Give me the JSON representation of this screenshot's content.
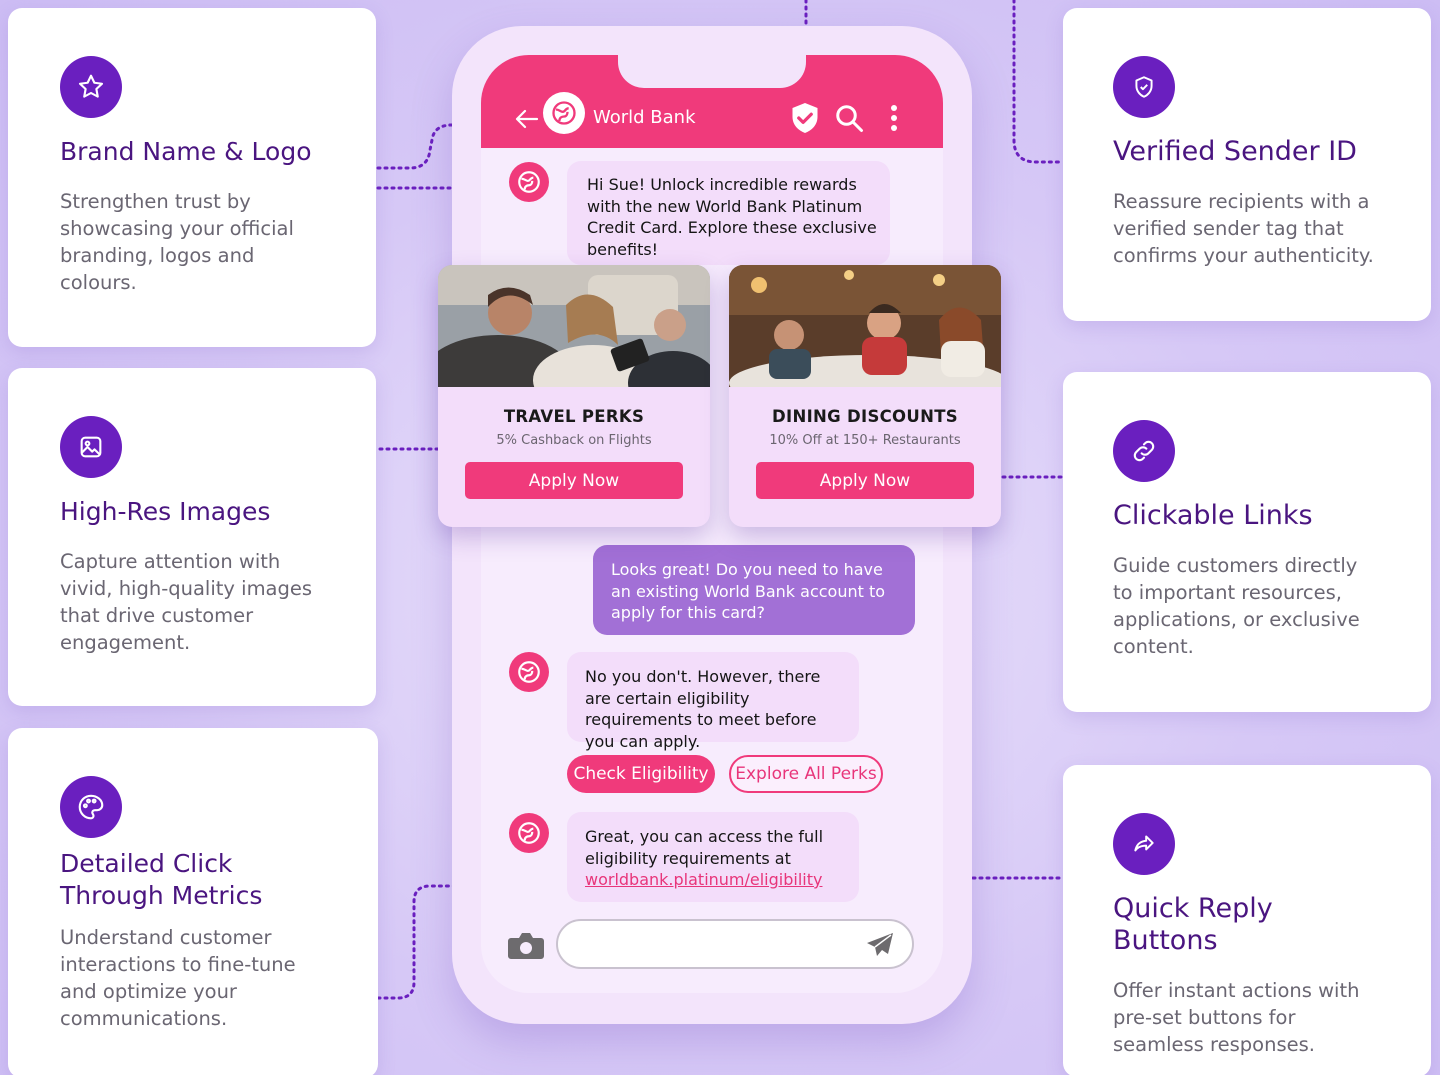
{
  "features": {
    "brand": {
      "title": "Brand Name & Logo",
      "desc": "Strengthen trust by showcasing your official branding, logos and colours.",
      "icon": "star-icon"
    },
    "images": {
      "title": "High-Res Images",
      "desc": "Capture attention with vivid, high-quality images that drive customer engagement.",
      "icon": "image-icon"
    },
    "metrics": {
      "title": "Detailed Click Through Metrics",
      "desc": "Understand customer interactions to fine-tune and optimize your communications.",
      "icon": "palette-icon"
    },
    "verified": {
      "title": "Verified Sender ID",
      "desc": "Reassure recipients with a verified sender tag that confirms your authenticity.",
      "icon": "shield-check-icon"
    },
    "links": {
      "title": "Clickable Links",
      "desc": "Guide customers directly to important resources, applications, or exclusive content.",
      "icon": "link-icon"
    },
    "replies": {
      "title": "Quick Reply Buttons",
      "desc": "Offer instant actions with pre-set buttons for seamless responses.",
      "icon": "share-arrow-icon"
    }
  },
  "phone": {
    "brand_name": "World Bank",
    "messages": {
      "m1": "Hi Sue! Unlock incredible rewards with the new World Bank Platinum Credit Card. Explore these exclusive benefits!",
      "m2": "Looks great! Do you need to have an existing World Bank account to apply for this card?",
      "m3": "No you don't. However, there are certain eligibility requirements to meet before you can apply.",
      "m4_text": "Great, you can access the full eligibility requirements at",
      "m4_link": "worldbank.platinum/eligibility"
    },
    "promos": [
      {
        "title": "TRAVEL PERKS",
        "subtitle": "5% Cashback on Flights",
        "button": "Apply Now"
      },
      {
        "title": "DINING DISCOUNTS",
        "subtitle": "10% Off at 150+ Restaurants",
        "button": "Apply Now"
      }
    ],
    "quick_replies": [
      "Check Eligibility",
      "Explore All Perks"
    ],
    "composer_placeholder": ""
  },
  "colors": {
    "brand_pink": "#f03a7b",
    "badge_purple": "#6a1fbf",
    "title_purple": "#4a1580",
    "user_bubble": "#a270d6"
  }
}
